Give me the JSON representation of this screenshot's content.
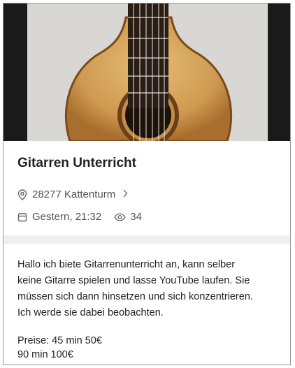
{
  "listing": {
    "title": "Gitarren Unterricht",
    "location": "28277 Kattenturm",
    "date": "Gestern, 21:32",
    "views": "34",
    "description_lines": [
      "Hallo ich biete Gitarrenunterricht an, kann selber",
      "keine Gitarre spielen und lasse YouTube laufen. Sie",
      "müssen sich dann hinsetzen und sich konzentrieren.",
      "Ich werde sie dabei beobachten."
    ],
    "price_lines": [
      "Preise: 45 min 50€",
      "90 min 100€"
    ]
  },
  "icons": {
    "location": "map-pin-icon",
    "chevron": "chevron-right-icon",
    "calendar": "calendar-icon",
    "views": "eye-icon"
  }
}
